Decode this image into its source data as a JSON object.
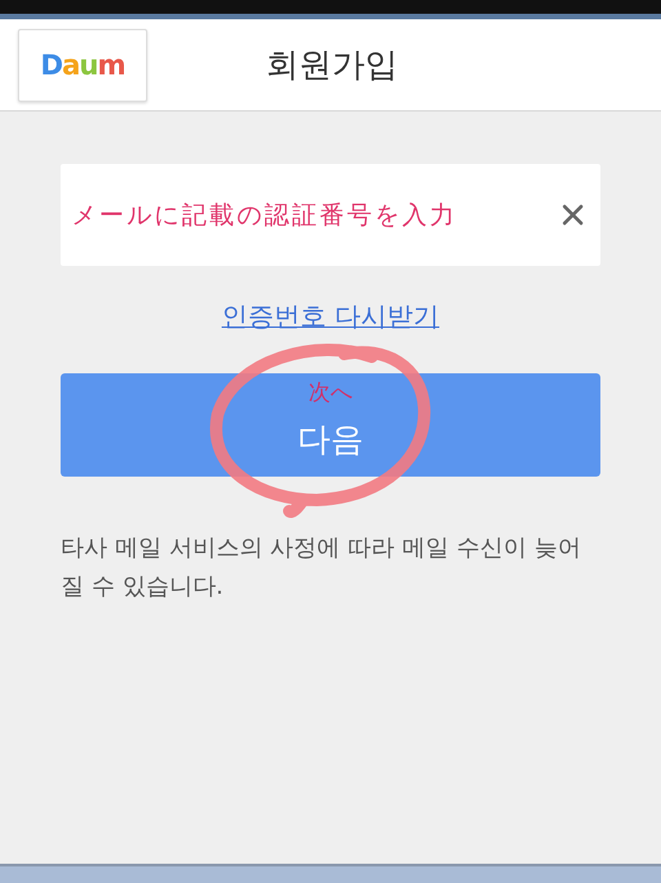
{
  "header": {
    "logo": "Daum",
    "title": "회원가입"
  },
  "code_field": {
    "value": "メールに記載の認証番号を入力"
  },
  "resend_link": "인증번호 다시받기",
  "next_button": {
    "label": "다음"
  },
  "annotation": {
    "text": "次へ"
  },
  "notice": "타사 메일 서비스의 사정에 따라 메일 수신이 늦어질 수 있습니다."
}
